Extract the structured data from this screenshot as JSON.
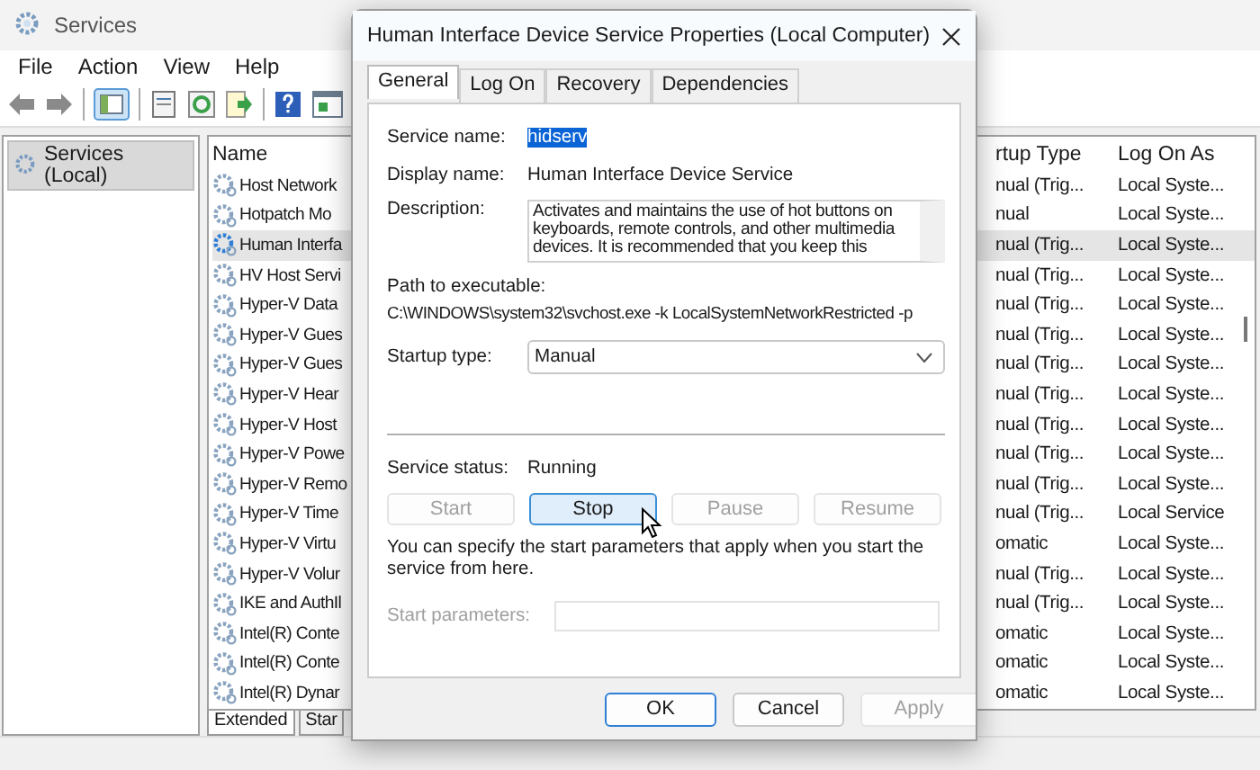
{
  "window": {
    "title": "Services"
  },
  "menu": [
    {
      "label": "File"
    },
    {
      "label": "Action"
    },
    {
      "label": "View"
    },
    {
      "label": "Help"
    }
  ],
  "tree": {
    "items": [
      {
        "label": "Services (Local)",
        "selected": true
      }
    ]
  },
  "list": {
    "columns": [
      "Name",
      "rtup Type",
      "Log On As"
    ],
    "rows": [
      {
        "name": "Host Network",
        "startup": "nual (Trig...",
        "logon": "Local Syste...",
        "selected": false
      },
      {
        "name": "Hotpatch Mo",
        "startup": "nual",
        "logon": "Local Syste...",
        "selected": false
      },
      {
        "name": "Human Interfa",
        "startup": "nual (Trig...",
        "logon": "Local Syste...",
        "selected": true
      },
      {
        "name": "HV Host Servi",
        "startup": "nual (Trig...",
        "logon": "Local Syste...",
        "selected": false
      },
      {
        "name": "Hyper-V Data",
        "startup": "nual (Trig...",
        "logon": "Local Syste...",
        "selected": false
      },
      {
        "name": "Hyper-V Gues",
        "startup": "nual (Trig...",
        "logon": "Local Syste...",
        "selected": false
      },
      {
        "name": "Hyper-V Gues",
        "startup": "nual (Trig...",
        "logon": "Local Syste...",
        "selected": false
      },
      {
        "name": "Hyper-V Hear",
        "startup": "nual (Trig...",
        "logon": "Local Syste...",
        "selected": false
      },
      {
        "name": "Hyper-V Host",
        "startup": "nual (Trig...",
        "logon": "Local Syste...",
        "selected": false
      },
      {
        "name": "Hyper-V Powe",
        "startup": "nual (Trig...",
        "logon": "Local Syste...",
        "selected": false
      },
      {
        "name": "Hyper-V Remo",
        "startup": "nual (Trig...",
        "logon": "Local Syste...",
        "selected": false
      },
      {
        "name": "Hyper-V Time",
        "startup": "nual (Trig...",
        "logon": "Local Service",
        "selected": false
      },
      {
        "name": "Hyper-V Virtu",
        "startup": "omatic",
        "logon": "Local Syste...",
        "selected": false
      },
      {
        "name": "Hyper-V Volur",
        "startup": "nual (Trig...",
        "logon": "Local Syste...",
        "selected": false
      },
      {
        "name": "IKE and AuthIl",
        "startup": "nual (Trig...",
        "logon": "Local Syste...",
        "selected": false
      },
      {
        "name": "Intel(R) Conte",
        "startup": "omatic",
        "logon": "Local Syste...",
        "selected": false
      },
      {
        "name": "Intel(R) Conte",
        "startup": "omatic",
        "logon": "Local Syste...",
        "selected": false
      },
      {
        "name": "Intel(R) Dynar",
        "startup": "omatic",
        "logon": "Local Syste...",
        "selected": false
      }
    ],
    "view_tabs": [
      {
        "label": "Extended",
        "selected": true
      },
      {
        "label": "Star",
        "selected": false
      }
    ]
  },
  "dialog": {
    "title": "Human Interface Device Service Properties (Local Computer)",
    "tabs": [
      {
        "label": "General",
        "selected": true
      },
      {
        "label": "Log On",
        "selected": false
      },
      {
        "label": "Recovery",
        "selected": false
      },
      {
        "label": "Dependencies",
        "selected": false
      }
    ],
    "service_name_label": "Service name:",
    "service_name": "hidserv",
    "display_name_label": "Display name:",
    "display_name": "Human Interface Device Service",
    "description_label": "Description:",
    "description": "Activates and maintains the use of hot buttons on keyboards, remote controls, and other multimedia devices. It is recommended that you keep this",
    "path_label": "Path to executable:",
    "path": "C:\\WINDOWS\\system32\\svchost.exe -k LocalSystemNetworkRestricted -p",
    "startup_label": "Startup type:",
    "startup_value": "Manual",
    "status_label": "Service status:",
    "status": "Running",
    "control_buttons": [
      {
        "label": "Start",
        "disabled": true
      },
      {
        "label": "Stop",
        "disabled": false
      },
      {
        "label": "Pause",
        "disabled": true
      },
      {
        "label": "Resume",
        "disabled": true
      }
    ],
    "hint": "You can specify the start parameters that apply when you start the service from here.",
    "params": {
      "label": "Start parameters:",
      "disabled": true
    },
    "buttons": [
      {
        "label": "OK",
        "disabled": false
      },
      {
        "label": "Cancel",
        "disabled": false
      },
      {
        "label": "Apply",
        "disabled": true
      }
    ]
  }
}
